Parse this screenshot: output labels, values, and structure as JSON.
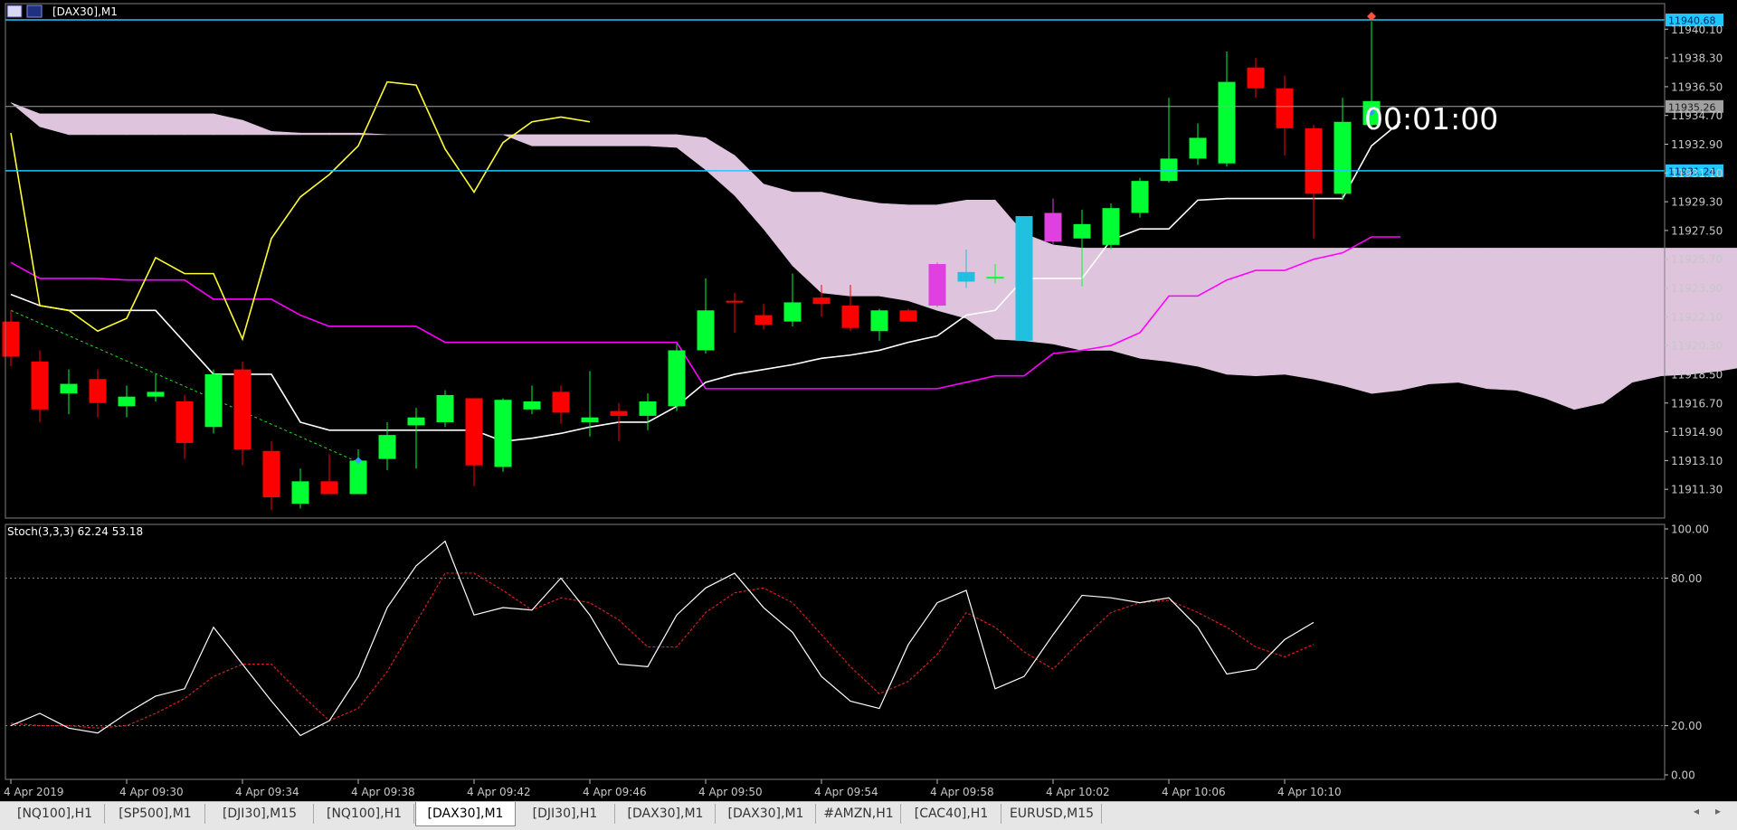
{
  "window": {
    "title": "[DAX30],M1"
  },
  "price_axis": {
    "labels": [
      "11940.10",
      "11938.30",
      "11936.50",
      "11934.70",
      "11932.90",
      "11931.10",
      "11929.30",
      "11927.50",
      "11925.70",
      "11923.90",
      "11922.10",
      "11920.30",
      "11918.50",
      "11916.70",
      "11914.90",
      "11913.10",
      "11911.30"
    ],
    "tags": [
      {
        "text": "11940.68",
        "value": 11940.68,
        "color": "#1ec8ff"
      },
      {
        "text": "11935.26",
        "value": 11935.26,
        "color": "#a0a0a0"
      },
      {
        "text": "11931.24",
        "value": 11931.24,
        "color": "#1ec8ff"
      }
    ]
  },
  "timer": "00:01:00",
  "stoch": {
    "label": "Stoch(3,3,3) 62.24 53.18",
    "axis_labels": [
      "100.00",
      "80.00",
      "20.00",
      "0.00"
    ]
  },
  "time_axis": [
    "4 Apr 2019",
    "4 Apr 09:30",
    "4 Apr 09:34",
    "4 Apr 09:38",
    "4 Apr 09:42",
    "4 Apr 09:46",
    "4 Apr 09:50",
    "4 Apr 09:54",
    "4 Apr 09:58",
    "4 Apr 10:02",
    "4 Apr 10:06",
    "4 Apr 10:10"
  ],
  "tabs": [
    {
      "label": "[NQ100],H1",
      "active": false
    },
    {
      "label": "[SP500],M1",
      "active": false
    },
    {
      "label": "[DJI30],M15",
      "active": false
    },
    {
      "label": "[NQ100],H1",
      "active": false
    },
    {
      "label": "[DAX30],M1",
      "active": true
    },
    {
      "label": "[DJI30],H1",
      "active": false
    },
    {
      "label": "[DAX30],M1",
      "active": false
    },
    {
      "label": "[DAX30],M1",
      "active": false
    },
    {
      "label": "#AMZN,H1",
      "active": false
    },
    {
      "label": "[CAC40],H1",
      "active": false
    },
    {
      "label": "EURUSD,M15",
      "active": false
    }
  ],
  "colors": {
    "bull": "#00ff33",
    "bear": "#ff0000",
    "cloud": "#dec4dc",
    "tenkan": "#ffffff",
    "kijun": "#ff00ff",
    "chikou": "#ffff33",
    "hline": "#1ec8ff",
    "stoch_main": "#ffffff",
    "stoch_signal": "#d42020"
  },
  "chart_data": {
    "type": "candlestick",
    "symbol": "[DAX30]",
    "timeframe": "M1",
    "ylim": [
      11909.5,
      11941.7
    ],
    "candles": [
      {
        "o": 11921.8,
        "h": 11922.5,
        "l": 11919.0,
        "c": 11919.6
      },
      {
        "o": 11919.3,
        "h": 11920.0,
        "l": 11915.5,
        "c": 11916.3
      },
      {
        "o": 11917.3,
        "h": 11918.8,
        "l": 11916.0,
        "c": 11917.9
      },
      {
        "o": 11918.2,
        "h": 11918.8,
        "l": 11915.8,
        "c": 11916.7
      },
      {
        "o": 11916.5,
        "h": 11917.8,
        "l": 11915.8,
        "c": 11917.1
      },
      {
        "o": 11917.1,
        "h": 11918.5,
        "l": 11916.8,
        "c": 11917.4
      },
      {
        "o": 11916.8,
        "h": 11917.2,
        "l": 11913.2,
        "c": 11914.2
      },
      {
        "o": 11915.2,
        "h": 11918.8,
        "l": 11914.8,
        "c": 11918.5
      },
      {
        "o": 11918.8,
        "h": 11919.3,
        "l": 11912.8,
        "c": 11913.8
      },
      {
        "o": 11913.7,
        "h": 11914.3,
        "l": 11910.0,
        "c": 11910.8
      },
      {
        "o": 11910.4,
        "h": 11912.6,
        "l": 11910.1,
        "c": 11911.8
      },
      {
        "o": 11911.8,
        "h": 11913.5,
        "l": 11911.0,
        "c": 11911.0
      },
      {
        "o": 11911.0,
        "h": 11913.8,
        "l": 11911.0,
        "c": 11913.1
      },
      {
        "o": 11913.2,
        "h": 11915.5,
        "l": 11912.5,
        "c": 11914.7
      },
      {
        "o": 11915.3,
        "h": 11916.4,
        "l": 11912.6,
        "c": 11915.8
      },
      {
        "o": 11915.5,
        "h": 11917.5,
        "l": 11915.2,
        "c": 11917.2
      },
      {
        "o": 11917.0,
        "h": 11917.0,
        "l": 11911.5,
        "c": 11912.8
      },
      {
        "o": 11912.7,
        "h": 11917.0,
        "l": 11912.4,
        "c": 11916.9
      },
      {
        "o": 11916.3,
        "h": 11917.8,
        "l": 11916.0,
        "c": 11916.8
      },
      {
        "o": 11917.4,
        "h": 11917.8,
        "l": 11915.4,
        "c": 11916.1
      },
      {
        "o": 11915.5,
        "h": 11918.7,
        "l": 11914.6,
        "c": 11915.8
      },
      {
        "o": 11916.2,
        "h": 11916.7,
        "l": 11914.3,
        "c": 11915.9
      },
      {
        "o": 11915.9,
        "h": 11917.3,
        "l": 11915.0,
        "c": 11916.8
      },
      {
        "o": 11916.5,
        "h": 11920.4,
        "l": 11916.2,
        "c": 11920.0
      },
      {
        "o": 11920.0,
        "h": 11924.5,
        "l": 11919.8,
        "c": 11922.5
      },
      {
        "o": 11923.1,
        "h": 11923.6,
        "l": 11921.1,
        "c": 11923.0
      },
      {
        "o": 11922.2,
        "h": 11922.9,
        "l": 11921.3,
        "c": 11921.6
      },
      {
        "o": 11921.8,
        "h": 11924.8,
        "l": 11921.5,
        "c": 11923.0
      },
      {
        "o": 11923.3,
        "h": 11924.1,
        "l": 11922.1,
        "c": 11922.9
      },
      {
        "o": 11922.8,
        "h": 11924.1,
        "l": 11921.2,
        "c": 11921.4
      },
      {
        "o": 11921.2,
        "h": 11922.6,
        "l": 11920.6,
        "c": 11922.5
      },
      {
        "o": 11922.5,
        "h": 11922.6,
        "l": 11921.8,
        "c": 11921.8
      },
      {
        "o": 11922.8,
        "h": 11925.5,
        "l": 11922.7,
        "c": 11925.4
      },
      {
        "o": 11924.3,
        "h": 11926.3,
        "l": 11923.9,
        "c": 11924.9
      },
      {
        "o": 11924.6,
        "h": 11925.4,
        "l": 11924.2,
        "c": 11924.6
      },
      {
        "o": 11920.6,
        "h": 11928.4,
        "l": 11920.6,
        "c": 11928.4
      },
      {
        "o": 11928.6,
        "h": 11929.5,
        "l": 11926.6,
        "c": 11926.8
      },
      {
        "o": 11927.0,
        "h": 11928.8,
        "l": 11924.0,
        "c": 11927.9
      },
      {
        "o": 11926.6,
        "h": 11929.2,
        "l": 11926.3,
        "c": 11928.9
      },
      {
        "o": 11928.6,
        "h": 11930.8,
        "l": 11928.3,
        "c": 11930.6
      },
      {
        "o": 11930.6,
        "h": 11935.8,
        "l": 11930.5,
        "c": 11932.0
      },
      {
        "o": 11932.0,
        "h": 11934.2,
        "l": 11931.6,
        "c": 11933.3
      },
      {
        "o": 11931.7,
        "h": 11938.7,
        "l": 11931.5,
        "c": 11936.8
      },
      {
        "o": 11937.7,
        "h": 11938.3,
        "l": 11935.8,
        "c": 11936.4
      },
      {
        "o": 11936.4,
        "h": 11937.2,
        "l": 11932.2,
        "c": 11933.9
      },
      {
        "o": 11933.9,
        "h": 11934.1,
        "l": 11927.0,
        "c": 11929.8
      },
      {
        "o": 11929.8,
        "h": 11935.8,
        "l": 11929.4,
        "c": 11934.3
      },
      {
        "o": 11934.1,
        "h": 11940.6,
        "l": 11933.8,
        "c": 11935.6
      }
    ],
    "ichimoku": {
      "tenkan": [
        11923.5,
        11922.8,
        11922.5,
        11922.5,
        11922.5,
        11922.5,
        11920.5,
        11918.5,
        11918.5,
        11918.5,
        11915.5,
        11915.0,
        11915.0,
        11915.0,
        11915.0,
        11915.0,
        11915.0,
        11914.3,
        11914.5,
        11914.8,
        11915.2,
        11915.5,
        11915.5,
        11916.5,
        11918.0,
        11918.5,
        11918.8,
        11919.1,
        11919.5,
        11919.7,
        11920.0,
        11920.5,
        11920.9,
        11922.2,
        11922.5,
        11924.5,
        11924.5,
        11924.5,
        11926.9,
        11927.6,
        11927.6,
        11929.4,
        11929.5,
        11929.5,
        11929.5,
        11929.5,
        11929.5,
        11932.8,
        11934.3
      ],
      "kijun": [
        11925.5,
        11924.5,
        11924.5,
        11924.5,
        11924.4,
        11924.4,
        11924.4,
        11923.2,
        11923.2,
        11923.2,
        11922.2,
        11921.5,
        11921.5,
        11921.5,
        11921.5,
        11920.5,
        11920.5,
        11920.5,
        11920.5,
        11920.5,
        11920.5,
        11920.5,
        11920.5,
        11920.5,
        11917.6,
        11917.6,
        11917.6,
        11917.6,
        11917.6,
        11917.6,
        11917.6,
        11917.6,
        11917.6,
        11918.0,
        11918.4,
        11918.4,
        11919.8,
        11920.0,
        11920.3,
        11921.1,
        11923.4,
        11923.4,
        11924.4,
        11925.0,
        11925.0,
        11925.7,
        11926.1,
        11927.1,
        11927.1
      ],
      "chikou": [
        11933.6,
        11922.8,
        11922.5,
        11921.2,
        11922.0,
        11925.8,
        11924.8,
        11924.8,
        11920.7,
        11927.0,
        11929.6,
        11931.0,
        11932.8,
        11936.8,
        11936.6,
        11932.6,
        11929.9,
        11933.0,
        11934.3,
        11934.6,
        11934.3
      ],
      "senkou_a": [
        11935.5,
        11934.0,
        11933.5,
        11933.5,
        11933.5,
        11933.5,
        11933.5,
        11933.5,
        11933.5,
        11933.5,
        11933.5,
        11933.5,
        11933.5,
        11933.5,
        11933.5,
        11933.5,
        11933.5,
        11933.5,
        11932.8,
        11932.8,
        11932.8,
        11932.8,
        11932.8,
        11932.7,
        11931.3,
        11929.7,
        11927.6,
        11925.3,
        11923.6,
        11923.4,
        11923.4,
        11923.1,
        11922.5,
        11922.0,
        11920.7,
        11920.6,
        11920.4,
        11920.0,
        11920.0,
        11919.5,
        11919.3,
        11919.0,
        11918.5,
        11918.4,
        11918.5,
        11918.2,
        11917.8,
        11917.3,
        11917.5,
        11917.9,
        11918.0,
        11917.6,
        11917.5,
        11917.0,
        11916.3,
        11916.7,
        11918.0,
        11918.4,
        11918.5,
        11918.7,
        11919.0,
        11919.5,
        11919.6,
        11920.1,
        11920.6,
        11921.0
      ],
      "senkou_b": [
        11935.5,
        11934.8,
        11934.8,
        11934.8,
        11934.8,
        11934.8,
        11934.8,
        11934.8,
        11934.4,
        11933.7,
        11933.6,
        11933.6,
        11933.6,
        11933.5,
        11933.5,
        11933.5,
        11933.5,
        11933.5,
        11933.5,
        11933.5,
        11933.5,
        11933.5,
        11933.5,
        11933.5,
        11933.3,
        11932.2,
        11930.4,
        11929.9,
        11929.9,
        11929.5,
        11929.2,
        11929.1,
        11929.1,
        11929.4,
        11929.4,
        11927.3,
        11926.6,
        11926.4,
        11926.4,
        11926.4,
        11926.4,
        11926.4,
        11926.4,
        11926.4,
        11926.4,
        11926.4,
        11926.4,
        11926.4,
        11926.4,
        11926.4,
        11926.4,
        11926.4,
        11926.4,
        11926.4,
        11926.4,
        11926.4,
        11926.4,
        11926.4,
        11926.4,
        11926.4,
        11926.4,
        11921.0,
        11921.0,
        11921.0,
        11921.0,
        11921.0
      ]
    },
    "stochastic": {
      "k_period": 3,
      "d_period": 3,
      "slowing": 3,
      "ylim": [
        0,
        100
      ],
      "levels": [
        80,
        20
      ],
      "main": [
        20.0,
        25.0,
        19.0,
        17.0,
        25.0,
        32.0,
        35.0,
        60.0,
        45.0,
        30.0,
        16.0,
        22.0,
        40.0,
        68.0,
        85.0,
        95.0,
        65.0,
        68.0,
        67.0,
        80.0,
        65.0,
        45.0,
        44.0,
        65.0,
        76.0,
        82.0,
        68.0,
        58.0,
        40.0,
        30.0,
        27.0,
        53.0,
        70.0,
        75.0,
        35.0,
        40.0,
        57.0,
        73.0,
        72.0,
        70.0,
        72.0,
        60.0,
        41.0,
        43.0,
        55.0,
        62.0
      ],
      "signal": [
        21.0,
        20.0,
        20.0,
        19.0,
        20.0,
        25.0,
        31.0,
        40.0,
        45.0,
        45.0,
        33.0,
        22.0,
        27.0,
        42.0,
        62.0,
        82.0,
        82.0,
        75.0,
        67.0,
        72.0,
        70.0,
        63.0,
        52.0,
        52.0,
        66.0,
        74.0,
        76.0,
        70.0,
        57.0,
        44.0,
        33.0,
        38.0,
        49.0,
        66.0,
        60.0,
        50.0,
        43.0,
        55.0,
        66.0,
        70.0,
        71.0,
        66.0,
        60.0,
        52.0,
        48.0,
        53.0
      ]
    }
  }
}
